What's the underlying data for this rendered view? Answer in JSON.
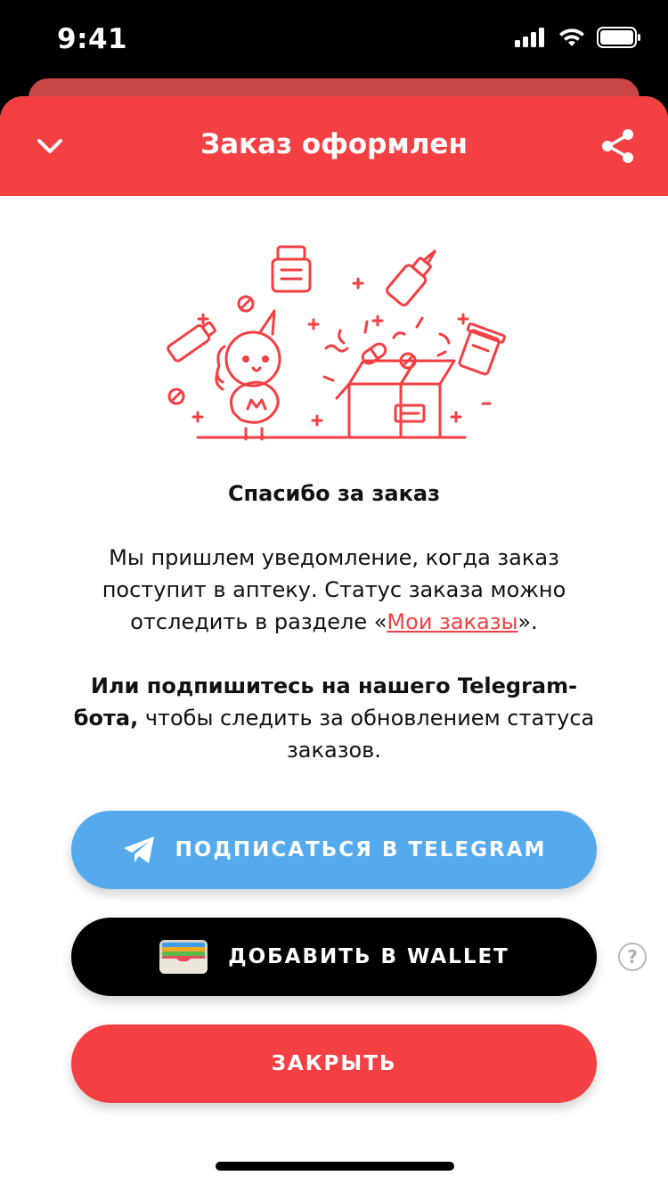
{
  "status_bar": {
    "time": "9:41"
  },
  "header": {
    "title": "Заказ оформлен"
  },
  "thanks_title": "Спасибо за заказ",
  "info": {
    "text_before": "Мы пришлем уведомление, когда заказ поступит в аптеку. Статус заказа можно отследить в разделе «",
    "link": "Мои заказы",
    "text_after": "»."
  },
  "telegram_info": {
    "bold": "Или подпишитесь на нашего Telegram-бота,",
    "rest": " чтобы следить за обновлением статуса заказов."
  },
  "buttons": {
    "telegram": "ПОДПИСАТЬСЯ В TELEGRAM",
    "wallet": "ДОБАВИТЬ В WALLET",
    "close": "ЗАКРЫТЬ",
    "help": "?"
  },
  "colors": {
    "accent": "#f43f43",
    "telegram": "#55aaee",
    "wallet": "#000000"
  }
}
